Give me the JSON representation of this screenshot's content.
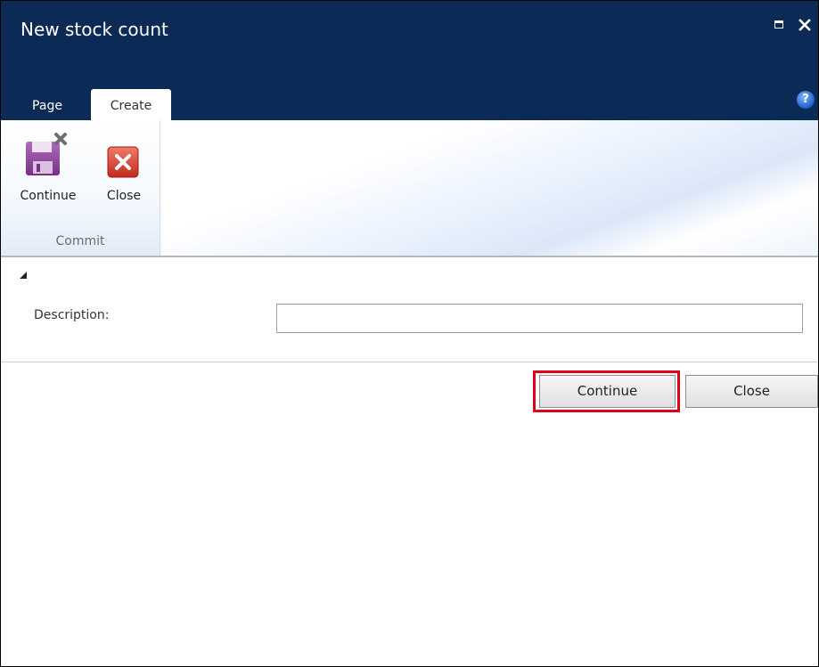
{
  "window": {
    "title": "New stock count",
    "maximize_icon": "maximize-icon",
    "close_icon": "close-icon"
  },
  "ribbon": {
    "tabs": [
      {
        "label": "Page",
        "active": false
      },
      {
        "label": "Create",
        "active": true
      }
    ],
    "help_icon": "help-icon",
    "help_glyph": "?",
    "groups": [
      {
        "label": "Commit",
        "buttons": [
          {
            "label": "Continue",
            "icon": "save-continue-icon"
          },
          {
            "label": "Close",
            "icon": "close-red-icon"
          }
        ]
      }
    ]
  },
  "form": {
    "collapse_icon": "collapse-triangle-icon",
    "description_label": "Description:",
    "description_value": ""
  },
  "actions": {
    "continue_label": "Continue",
    "close_label": "Close",
    "highlighted": "Continue"
  },
  "colors": {
    "title_bar": "#0b2a55",
    "highlight": "#e0001a",
    "save_icon": "#8b3a96",
    "close_icon": "#c9302c"
  }
}
